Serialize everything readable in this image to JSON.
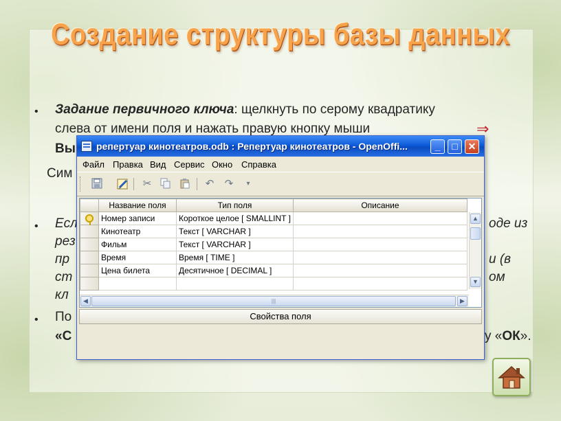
{
  "slide": {
    "title": "Создание структуры базы данных",
    "bullet1": {
      "lead": "Задание первичного ключа",
      "line1_rest": ": щелкнуть по серому квадратику",
      "line2": "слева от имени поля и нажать правую кнопку мыши",
      "line3_start": "Вы",
      "line4_start": "Сим"
    },
    "bullet2": {
      "line1_start": "Есл",
      "line1_end": "оде из",
      "line2_start": "рез",
      "line3_start": "пр",
      "line3_end": "и (в",
      "line4_start": "ст",
      "line4_end": "ом",
      "line5_start": "кл"
    },
    "bullet3": {
      "line1_start": "По",
      "line2_start": "«С",
      "line2_end_pre": "у «",
      "line2_ok": "ОК",
      "line2_end_post": "»."
    },
    "bullet_char": "•",
    "arrow": "⇒"
  },
  "window": {
    "title": "репертуар кинотеатров.odb : Репертуар кинотеатров - OpenOffi...",
    "buttons": {
      "minimize": "_",
      "maximize": "□",
      "close": "✕"
    },
    "menu": [
      "Файл",
      "Правка",
      "Вид",
      "Сервис",
      "Окно",
      "Справка"
    ],
    "toolbar_icons": [
      "save-icon",
      "edit-icon",
      "cut-icon",
      "copy-icon",
      "paste-icon",
      "undo-icon",
      "redo-icon",
      "dropdown-icon"
    ],
    "grid": {
      "headers": [
        "Название поля",
        "Тип поля",
        "Описание"
      ],
      "rows": [
        {
          "name": "Номер записи",
          "type": "Короткое целое [ SMALLINT ]",
          "desc": "",
          "primary_key": true
        },
        {
          "name": "Кинотеатр",
          "type": "Текст [ VARCHAR ]",
          "desc": ""
        },
        {
          "name": "Фильм",
          "type": "Текст [ VARCHAR ]",
          "desc": ""
        },
        {
          "name": "Время",
          "type": "Время [ TIME ]",
          "desc": ""
        },
        {
          "name": "Цена билета",
          "type": "Десятичное [ DECIMAL ]",
          "desc": ""
        },
        {
          "name": "",
          "type": "",
          "desc": ""
        }
      ]
    },
    "properties_title": "Свойства поля"
  },
  "colors": {
    "title": "#f6a34b",
    "xp_titlebar": "#0e5bd8",
    "arrow": "#c0262d"
  }
}
